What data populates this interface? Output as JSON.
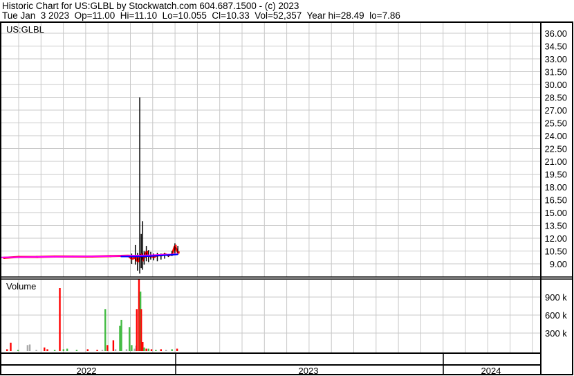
{
  "header": {
    "line1": "Historic Chart for US:GLBL by Stockwatch.com 604.687.1500 - (c) 2023",
    "line2": "Tue Jan  3 2023  Op=11.00  Hi=11.10  Lo=10.055  Cl=10.33  Vol=52,357  Year hi=28.49  lo=7.86"
  },
  "chart_data": [
    {
      "type": "line",
      "title": "US:GLBL",
      "ylim": [
        7.5,
        37.2
      ],
      "yticks": [
        "36.00",
        "34.50",
        "33.00",
        "31.50",
        "30.00",
        "28.50",
        "27.00",
        "25.50",
        "24.00",
        "22.50",
        "21.00",
        "19.50",
        "18.00",
        "16.50",
        "15.00",
        "13.50",
        "12.00",
        "10.50",
        "9.00"
      ],
      "x_unit": "day offset from 2022-01-01",
      "xlim": [
        125,
        1095
      ],
      "bars": [
        [
          130,
          9.65,
          9.8,
          9.7
        ],
        [
          150,
          9.7,
          9.85,
          9.8
        ],
        [
          175,
          9.75,
          9.9,
          9.8
        ],
        [
          200,
          9.75,
          9.9,
          9.85
        ],
        [
          225,
          9.8,
          9.95,
          9.85
        ],
        [
          250,
          9.8,
          9.9,
          9.85
        ],
        [
          275,
          9.85,
          9.95,
          9.9
        ],
        [
          300,
          9.85,
          10.0,
          9.95
        ],
        [
          305,
          9.0,
          10.2,
          9.6
        ],
        [
          310,
          8.9,
          11.2,
          9.7
        ],
        [
          313,
          8.2,
          10.3,
          9.3
        ],
        [
          316,
          7.86,
          28.49,
          9.8
        ],
        [
          318,
          8.5,
          12.5,
          10.1
        ],
        [
          320,
          8.3,
          14.0,
          9.4
        ],
        [
          322,
          8.9,
          10.5,
          9.8
        ],
        [
          325,
          9.3,
          11.1,
          10.4
        ],
        [
          328,
          9.2,
          10.6,
          9.9
        ],
        [
          331,
          9.5,
          10.4,
          9.9
        ],
        [
          335,
          9.4,
          10.2,
          9.8
        ],
        [
          340,
          9.3,
          10.3,
          10.0
        ],
        [
          345,
          9.5,
          10.2,
          10.0
        ],
        [
          350,
          9.6,
          10.3,
          10.1
        ],
        [
          355,
          9.8,
          10.1,
          10.0
        ],
        [
          360,
          9.9,
          10.5,
          10.1
        ],
        [
          364,
          10.2,
          11.4,
          11.1
        ],
        [
          368,
          10.055,
          11.1,
          10.33
        ]
      ],
      "ma_fast": [
        [
          127,
          9.75
        ],
        [
          170,
          9.8
        ],
        [
          230,
          9.85
        ],
        [
          280,
          9.9
        ],
        [
          300,
          9.95
        ],
        [
          330,
          10.0
        ],
        [
          360,
          10.1
        ],
        [
          368,
          10.15
        ]
      ],
      "ma_slow": [
        [
          290,
          9.85
        ],
        [
          310,
          9.85
        ],
        [
          330,
          9.9
        ],
        [
          350,
          10.0
        ],
        [
          368,
          10.1
        ]
      ],
      "colors": {
        "up": "#ff0000",
        "bar": "#000000",
        "ma_fast": "#ff00ff",
        "ma_slow": "#0000ff"
      }
    },
    {
      "type": "bar",
      "title": "Volume",
      "ylim": [
        0,
        1200000
      ],
      "yticks": [
        "900 k",
        "600 k",
        "300 k"
      ],
      "volume": [
        [
          140,
          140000,
          "red"
        ],
        [
          135,
          30000,
          "red"
        ],
        [
          150,
          20000,
          "green"
        ],
        [
          163,
          100000,
          "gray"
        ],
        [
          166,
          110000,
          "gray"
        ],
        [
          175,
          20000,
          "gray"
        ],
        [
          186,
          60000,
          "red"
        ],
        [
          190,
          30000,
          "red"
        ],
        [
          200,
          20000,
          "green"
        ],
        [
          207,
          1050000,
          "red"
        ],
        [
          212,
          30000,
          "green"
        ],
        [
          217,
          40000,
          "green"
        ],
        [
          230,
          20000,
          "green"
        ],
        [
          245,
          30000,
          "red"
        ],
        [
          258,
          20000,
          "red"
        ],
        [
          265,
          20000,
          "gray"
        ],
        [
          269,
          700000,
          "green"
        ],
        [
          272,
          100000,
          "red"
        ],
        [
          280,
          180000,
          "red"
        ],
        [
          283,
          30000,
          "gray"
        ],
        [
          289,
          420000,
          "green"
        ],
        [
          291,
          520000,
          "green"
        ],
        [
          298,
          30000,
          "gray"
        ],
        [
          302,
          400000,
          "green"
        ],
        [
          305,
          100000,
          "green"
        ],
        [
          309,
          40000,
          "gray"
        ],
        [
          311,
          90000,
          "gray"
        ],
        [
          312,
          700000,
          "red"
        ],
        [
          315,
          1200000,
          "red"
        ],
        [
          317,
          990000,
          "green"
        ],
        [
          318,
          700000,
          "red"
        ],
        [
          320,
          150000,
          "red"
        ],
        [
          322,
          60000,
          "green"
        ],
        [
          325,
          40000,
          "red"
        ],
        [
          328,
          40000,
          "green"
        ],
        [
          332,
          30000,
          "red"
        ],
        [
          338,
          20000,
          "green"
        ],
        [
          345,
          30000,
          "red"
        ],
        [
          352,
          20000,
          "gray"
        ],
        [
          360,
          30000,
          "green"
        ],
        [
          367,
          40000,
          "red"
        ]
      ],
      "colors": {
        "red": "#ff0000",
        "green": "#44bb44",
        "gray": "#aaaaaa"
      }
    }
  ],
  "xaxis": {
    "years": [
      "2022",
      "2023",
      "2024"
    ]
  }
}
